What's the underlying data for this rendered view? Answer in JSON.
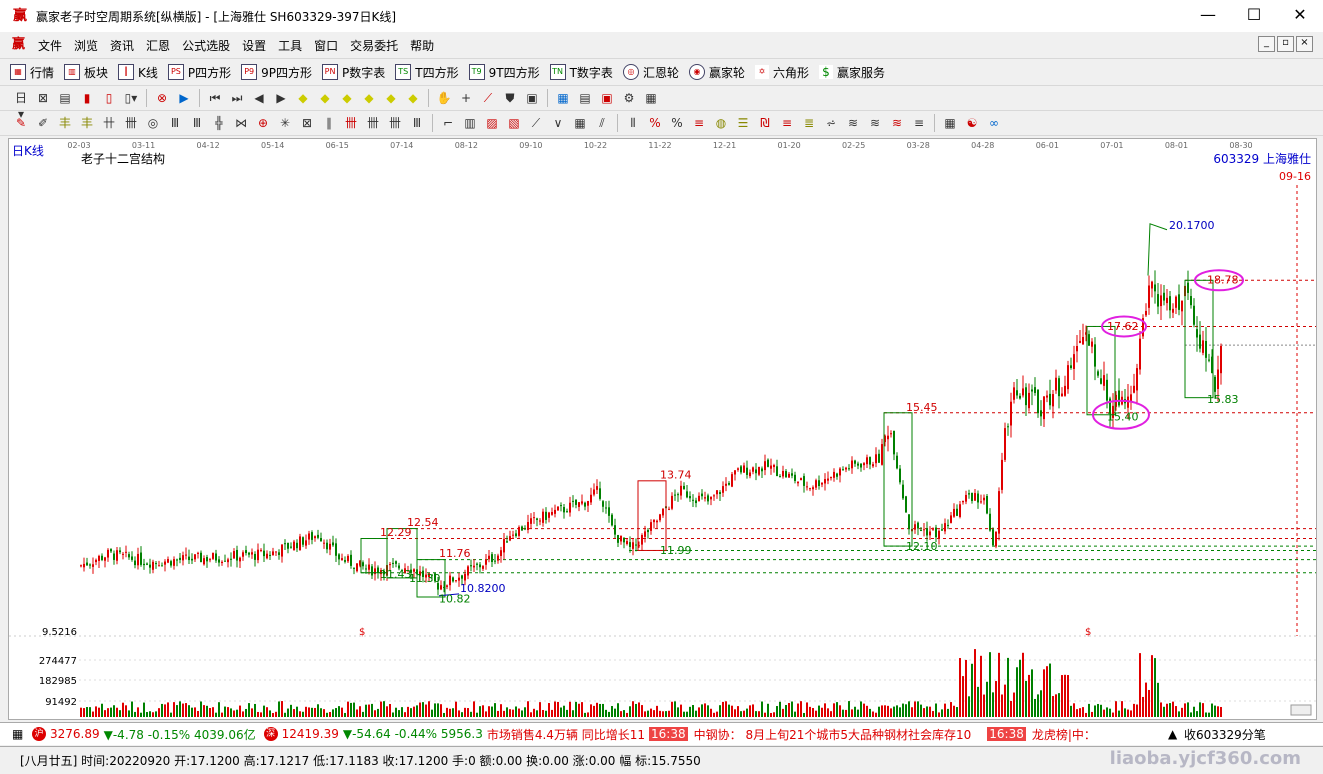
{
  "window": {
    "title": "赢家老子时空周期系统[纵横版] - [上海雅仕  SH603329-397日K线]",
    "min": "—",
    "max": "☐",
    "close": "✕"
  },
  "menu": [
    "文件",
    "浏览",
    "资讯",
    "汇恩",
    "公式选股",
    "设置",
    "工具",
    "窗口",
    "交易委托",
    "帮助"
  ],
  "toolbar1": [
    {
      "icon": "grid-icon",
      "label": "行情"
    },
    {
      "icon": "blocks-icon",
      "label": "板块"
    },
    {
      "icon": "kline-icon",
      "label": "K线"
    },
    {
      "icon": "ps-icon",
      "label": "P四方形"
    },
    {
      "icon": "p9-icon",
      "label": "9P四方形"
    },
    {
      "icon": "pn-icon",
      "label": "P数字表"
    },
    {
      "icon": "ts-icon",
      "label": "T四方形"
    },
    {
      "icon": "t9-icon",
      "label": "9T四方形"
    },
    {
      "icon": "tn-icon",
      "label": "T数字表"
    },
    {
      "icon": "wheel-icon",
      "label": "汇恩轮"
    },
    {
      "icon": "wheel2-icon",
      "label": "赢家轮"
    },
    {
      "icon": "hexagon-icon",
      "label": "六角形"
    },
    {
      "icon": "dollar-icon",
      "label": "赢家服务"
    }
  ],
  "chart": {
    "period_label": "日K线",
    "indicator_name": "老子十二宫结构",
    "code_label": "603329  上海雅仕",
    "last_date": "09-16",
    "date_ticks": [
      "02-03",
      "03-11",
      "04-12",
      "05-14",
      "06-15",
      "07-14",
      "08-12",
      "09-10",
      "10-22",
      "11-22",
      "12-21",
      "01-20",
      "02-25",
      "03-28",
      "04-28",
      "06-01",
      "07-01",
      "08-01",
      "08-30"
    ],
    "price_labels": {
      "p2017": "20.1700",
      "p1878": "18.78",
      "p1762": "17.62",
      "p1545": "15.45",
      "p1540": "15.40",
      "p1583": "15.83",
      "p1374": "13.74",
      "p1254": "12.54",
      "p1229": "12.29",
      "p1176": "11.76",
      "p1199": "11.99",
      "p1210": "12.10",
      "p1143": "11.43",
      "p1130": "11.30",
      "p1082b": "10.8200",
      "p1082": "10.82"
    },
    "volume_axis": [
      "9.5216",
      "274477",
      "182985",
      "91492"
    ],
    "marker": "$"
  },
  "chart_data": {
    "type": "candlestick",
    "title": "老子十二宫结构",
    "xlabel": "",
    "ylabel": "",
    "ylim": [
      10.0,
      21.0
    ],
    "x": [
      "02-03",
      "03-11",
      "04-12",
      "05-14",
      "06-15",
      "07-14",
      "08-12",
      "09-10",
      "10-22",
      "11-22",
      "12-21",
      "01-20",
      "02-25",
      "03-28",
      "04-28",
      "06-01",
      "07-01",
      "08-01",
      "08-30",
      "09-16"
    ],
    "approx_close": [
      11.6,
      11.9,
      11.8,
      11.9,
      12.4,
      11.4,
      11.2,
      12.6,
      12.2,
      13.6,
      13.9,
      14.0,
      14.4,
      12.5,
      15.0,
      16.5,
      15.8,
      18.0,
      16.6,
      17.1
    ],
    "levels": [
      20.17,
      18.78,
      17.62,
      15.83,
      15.45,
      15.4,
      13.74,
      12.54,
      12.29,
      12.1,
      11.99,
      11.76,
      11.43,
      11.3,
      10.82
    ],
    "volume_ticks": [
      274477,
      182985,
      91492
    ]
  },
  "status1": {
    "sh_index": "3276.89",
    "sh_change": "▼-4.78 -0.15% 4039.06亿",
    "sz_index": "12419.39",
    "sz_change": "▼-54.64 -0.44% 5956.3",
    "news1": "市场销售4.4万辆 同比增长11",
    "time1": "16:38",
    "news2": "中钢协：  8月上旬21个城市5大品种钢材社会库存10",
    "time2": "16:38",
    "news3": "龙虎榜|中：",
    "tick": "收603329分笔"
  },
  "status2": {
    "text": "[八月廿五] 时间:20220920 开:17.1200 高:17.1217 低:17.1183 收:17.1200 手:0 额:0.00 换:0.00 涨:0.00 幅 标:15.7550",
    "watermark": "liaoba.yjcf360.com"
  },
  "colors": {
    "up": "#e00000",
    "down": "#008000",
    "level_red": "#d00000",
    "level_green": "#008000",
    "circle": "#e020e0",
    "blue": "#0000c0"
  }
}
